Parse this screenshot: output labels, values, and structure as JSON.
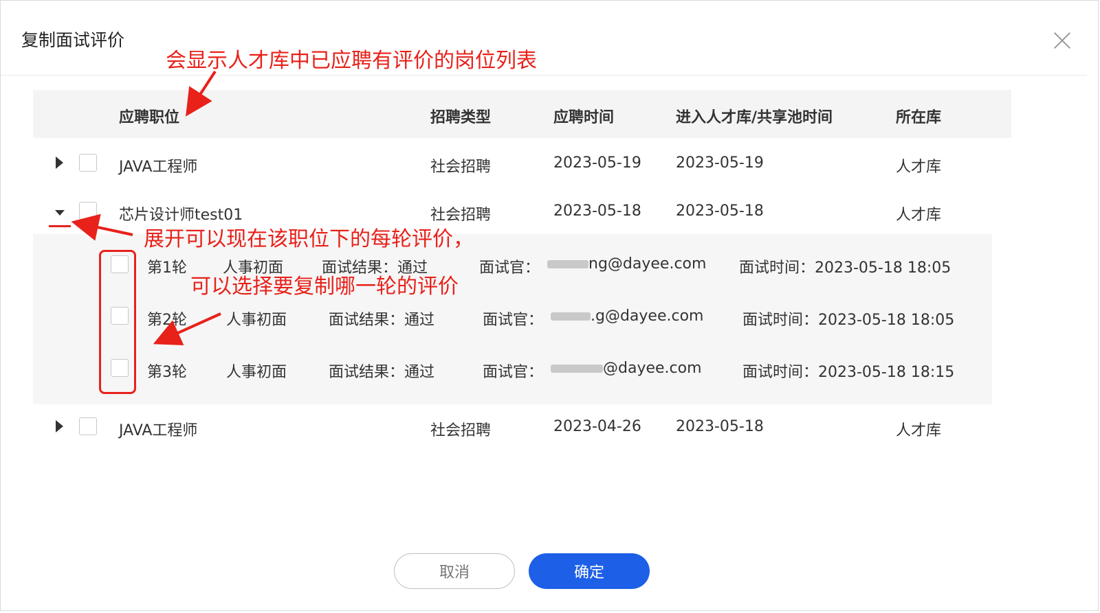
{
  "dialog": {
    "title": "复制面试评价",
    "cancel_label": "取消",
    "ok_label": "确定"
  },
  "table": {
    "columns": [
      "应聘职位",
      "招聘类型",
      "应聘时间",
      "进入人才库/共享池时间",
      "所在库"
    ],
    "rows": [
      {
        "position": "JAVA工程师",
        "type": "社会招聘",
        "apply_date": "2023-05-19",
        "enter_date": "2023-05-19",
        "pool": "人才库"
      },
      {
        "position": "芯片设计师test01",
        "type": "社会招聘",
        "apply_date": "2023-05-18",
        "enter_date": "2023-05-18",
        "pool": "人才库"
      },
      {
        "position": "JAVA工程师",
        "type": "社会招聘",
        "apply_date": "2023-04-26",
        "enter_date": "2023-05-18",
        "pool": "人才库"
      }
    ],
    "rounds": [
      {
        "round": "第1轮",
        "kind": "人事初面",
        "result": "面试结果：通过",
        "interviewer_label": "面试官：",
        "interviewer_email": "ng@dayee.com",
        "time": "面试时间：2023-05-18 18:05"
      },
      {
        "round": "第2轮",
        "kind": "人事初面",
        "result": "面试结果：通过",
        "interviewer_label": "面试官：",
        "interviewer_email": ".g@dayee.com",
        "time": "面试时间：2023-05-18 18:05"
      },
      {
        "round": "第3轮",
        "kind": "人事初面",
        "result": "面试结果：通过",
        "interviewer_label": "面试官：",
        "interviewer_email": "@dayee.com",
        "time": "面试时间：2023-05-18 18:15"
      }
    ]
  },
  "annotations": {
    "top": "会显示人才库中已应聘有评价的岗位列表",
    "expand": "展开可以现在该职位下的每轮评价，",
    "select": "可以选择要复制哪一轮的评价"
  },
  "colors": {
    "primary": "#1d5fe6",
    "annotation": "#e8211a"
  }
}
